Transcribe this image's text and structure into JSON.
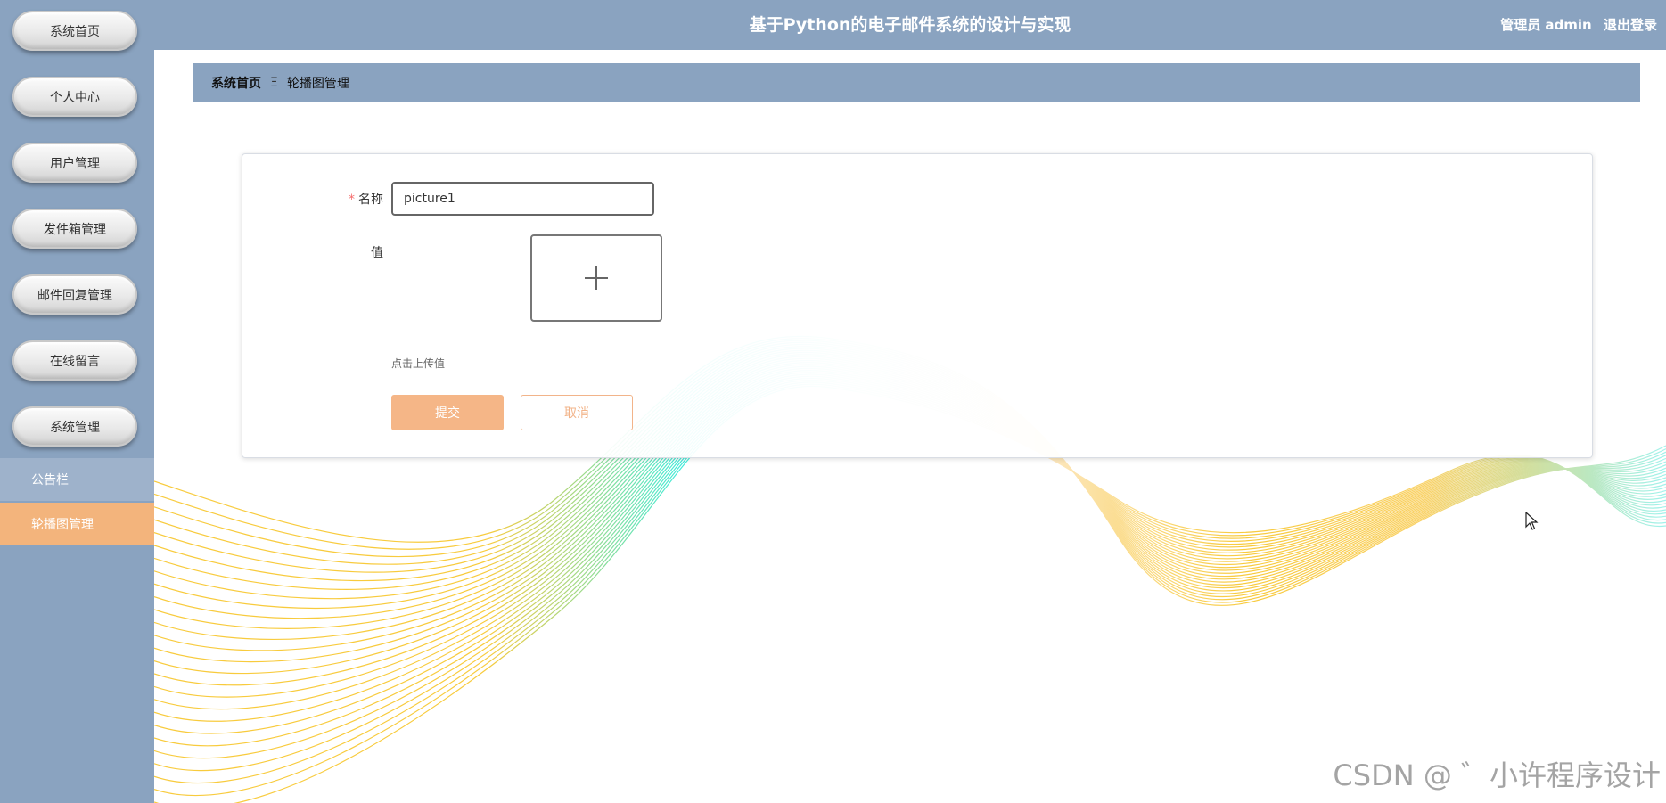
{
  "app": {
    "title": "基于Python的电子邮件系统的设计与实现",
    "user_label": "管理员 admin",
    "logout_label": "退出登录"
  },
  "sidebar": {
    "items": [
      {
        "label": "系统首页"
      },
      {
        "label": "个人中心"
      },
      {
        "label": "用户管理"
      },
      {
        "label": "发件箱管理"
      },
      {
        "label": "邮件回复管理"
      },
      {
        "label": "在线留言"
      },
      {
        "label": "系统管理"
      }
    ],
    "sub_items": [
      {
        "label": "公告栏",
        "active": false
      },
      {
        "label": "轮播图管理",
        "active": true
      }
    ]
  },
  "breadcrumb": {
    "home": "系统首页",
    "separator": "Ξ",
    "current": "轮播图管理"
  },
  "form": {
    "name_label": "名称",
    "name_value": "picture1",
    "value_label": "值",
    "upload_tip": "点击上传值",
    "submit_label": "提交",
    "cancel_label": "取消"
  },
  "watermark": "CSDN @ ゛小许程序设计",
  "colors": {
    "header": "#8aa3c0",
    "active": "#f3b47c",
    "submit": "#f5b687"
  }
}
